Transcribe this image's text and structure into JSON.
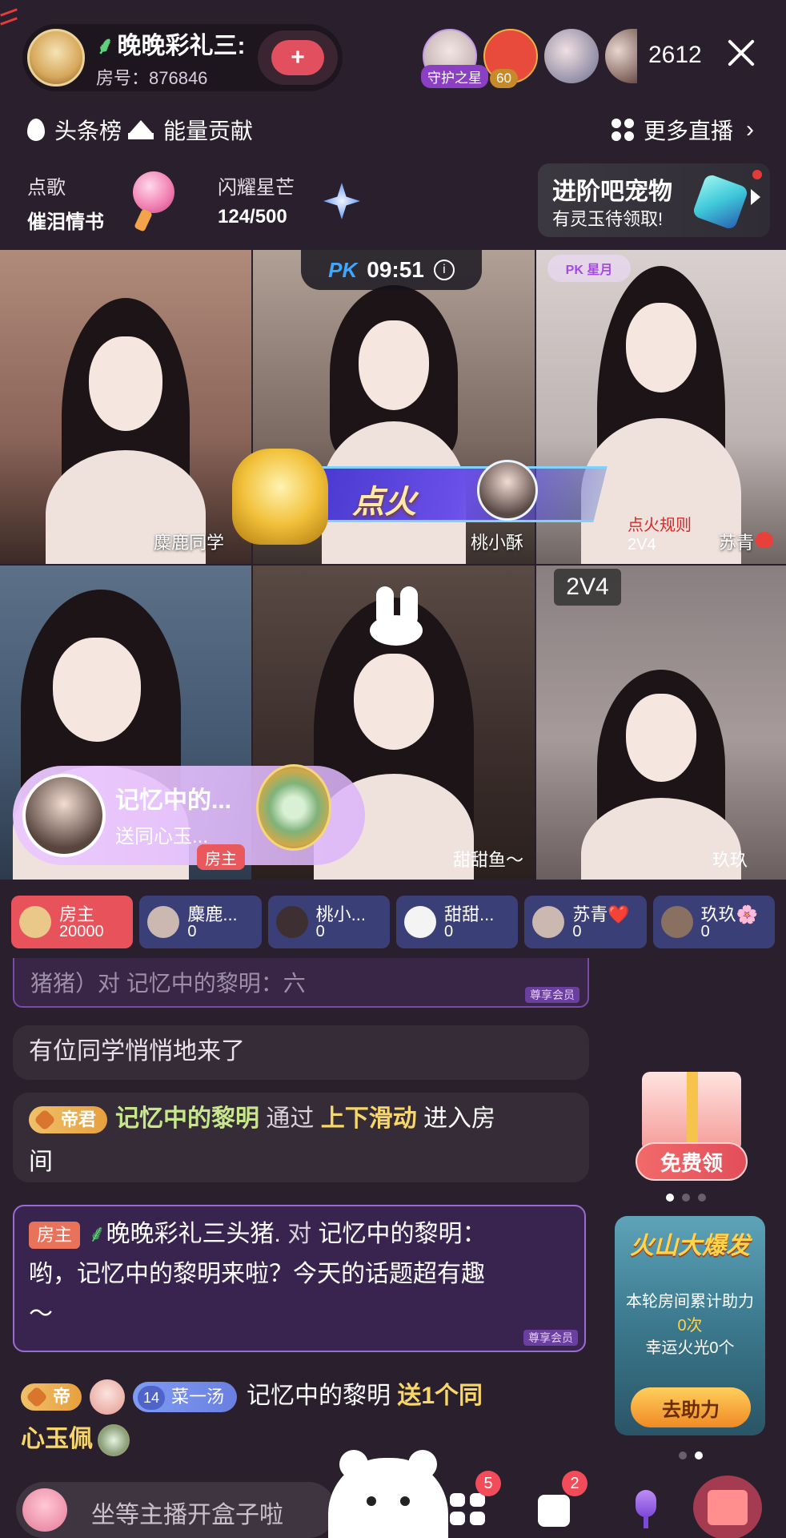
{
  "header": {
    "host_name": "晚晚彩礼三:",
    "room_number": "房号：876846",
    "follow_symbol": "+",
    "viewer_badges": [
      "守护之星",
      "60"
    ],
    "viewer_count": "2612"
  },
  "subnav": {
    "headline_rank": "头条榜",
    "energy": "能量贡献",
    "more_live": "更多直播"
  },
  "widgets": {
    "song_label": "点歌",
    "song_title": "催泪情书",
    "star_label": "闪耀星芒",
    "star_progress": "124/500",
    "pet_title": "进阶吧宠物",
    "pet_sub": "有灵玉待领取!"
  },
  "pk": {
    "timer": "09:51",
    "logo": "PK",
    "rank_badge": "PK 星月",
    "ignite": "点火",
    "mode": "2V4",
    "rules_text": "点火规则",
    "rules_sub": "2V4"
  },
  "grid": {
    "names": [
      "麋鹿同学",
      "桃小酥",
      "苏青",
      "",
      "甜甜鱼～",
      "玖玖"
    ]
  },
  "gift_toast": {
    "name": "记忆中的...",
    "sub": "送同心玉...",
    "role": "房主"
  },
  "scores": [
    {
      "name": "房主",
      "value": "20000"
    },
    {
      "name": "麋鹿...",
      "value": "0"
    },
    {
      "name": "桃小...",
      "value": "0"
    },
    {
      "name": "甜甜...",
      "value": "0"
    },
    {
      "name": "苏青❤️",
      "value": "0"
    },
    {
      "name": "玖玖🌸",
      "value": "0"
    }
  ],
  "chat": {
    "top_faded": "猪猪）对 记忆中的黎明：六",
    "faded_tag": "尊享会员",
    "line1": "有位同学悄悄地来了",
    "line2_tag": "帝君",
    "line2_user": "记忆中的黎明",
    "line2_via": "通过",
    "line2_action": "上下滑动",
    "line2_rest": "进入房",
    "line2_wrap": "间",
    "line3_role": "房主",
    "line3_user": "晚晚彩礼三头猪.",
    "line3_to": "对",
    "line3_target": "记忆中的黎明：",
    "line3_msg": "哟，记忆中的黎明来啦？今天的话题超有趣",
    "line3_wrap": "～",
    "line3_tag": "尊享会员",
    "line4_tag": "帝",
    "line4_fan_level": "14",
    "line4_fan_name": "菜一汤",
    "line4_user": "记忆中的黎明",
    "line4_action": "送1个同",
    "line4_wrap": "心玉佩"
  },
  "free_gift": {
    "label": "免费领"
  },
  "volcano": {
    "title": "火山大爆发",
    "line1": "本轮房间累计助力",
    "line2": "0次",
    "line3": "幸运火光0个",
    "button": "去助力"
  },
  "bottom": {
    "input_placeholder": "坐等主播开盒子啦",
    "badge_games": "5",
    "badge_msgs": "2"
  },
  "colors": {
    "background": "#2a1f2c",
    "host_chip": "#e8525a",
    "chip": "#3b3f78",
    "accent_yellow": "#f7d66a",
    "accent_green": "#c7e88a"
  }
}
